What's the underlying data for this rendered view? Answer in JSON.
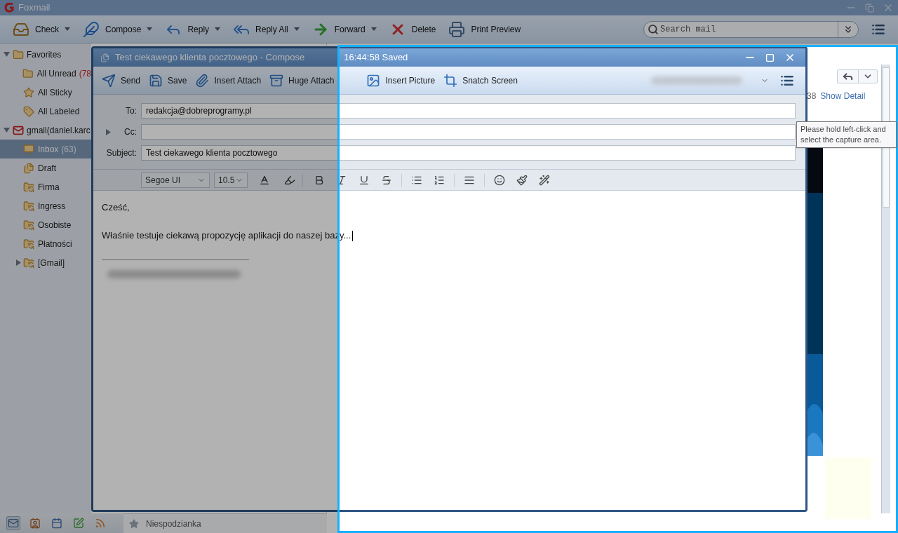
{
  "app": {
    "title": "Foxmail"
  },
  "toolbar": [
    {
      "label": "Check",
      "dropdown": true
    },
    {
      "label": "Compose",
      "dropdown": true
    },
    {
      "label": "Reply",
      "dropdown": true
    },
    {
      "label": "Reply All",
      "dropdown": true
    },
    {
      "label": "Forward",
      "dropdown": true
    },
    {
      "label": "Delete",
      "dropdown": false
    },
    {
      "label": "Print Preview",
      "dropdown": false
    }
  ],
  "search": {
    "placeholder": "Search mail"
  },
  "sidebar": [
    {
      "label": "Favorites",
      "expanded": true,
      "selected": false,
      "children": [
        {
          "label": "All Unread",
          "count": "(78",
          "selected": false
        },
        {
          "label": "All Sticky",
          "selected": false
        },
        {
          "label": "All Labeled",
          "selected": false
        }
      ]
    },
    {
      "label": "gmail(daniel.karc",
      "expanded": true,
      "selected": false,
      "children": [
        {
          "label": "Inbox",
          "count": "(63)",
          "selected": true
        },
        {
          "label": "Draft",
          "selected": false
        },
        {
          "label": "Firma",
          "selected": false
        },
        {
          "label": "Ingress",
          "selected": false
        },
        {
          "label": "Osobiste",
          "selected": false
        },
        {
          "label": "Płatności",
          "selected": false
        },
        {
          "label": "[Gmail]",
          "expanded": false,
          "selected": false
        }
      ]
    }
  ],
  "footer": {
    "tabs": [
      {
        "selected": true
      },
      {
        "selected": false
      },
      {
        "selected": false
      },
      {
        "selected": false
      },
      {
        "selected": false
      }
    ],
    "folder": "Niespodzianka"
  },
  "reading_pane": {
    "time": "38",
    "link": "Show Detail"
  },
  "compose": {
    "title": "Test ciekawego klienta pocztowego - Compose",
    "status": "16:44:58 Saved",
    "toolbar": [
      "Send",
      "Save",
      "Insert Attach",
      "Huge Attach",
      "Insert Picture",
      "Snatch Screen"
    ],
    "fields": [
      {
        "label": "To:",
        "value": "redakcja@dobreprogramy.pl"
      },
      {
        "label": "Cc:",
        "expanded": false
      },
      {
        "label": "Subject:",
        "value": "Test ciekawego klienta pocztowego"
      }
    ],
    "font": "Segoe UI",
    "size": "10.5",
    "body": [
      "Cześć,",
      "Właśnie testuje ciekawą propozycję aplikacji do naszej bazy..."
    ]
  },
  "capture": {
    "tooltip": "Please hold left-click and select the capture area."
  }
}
